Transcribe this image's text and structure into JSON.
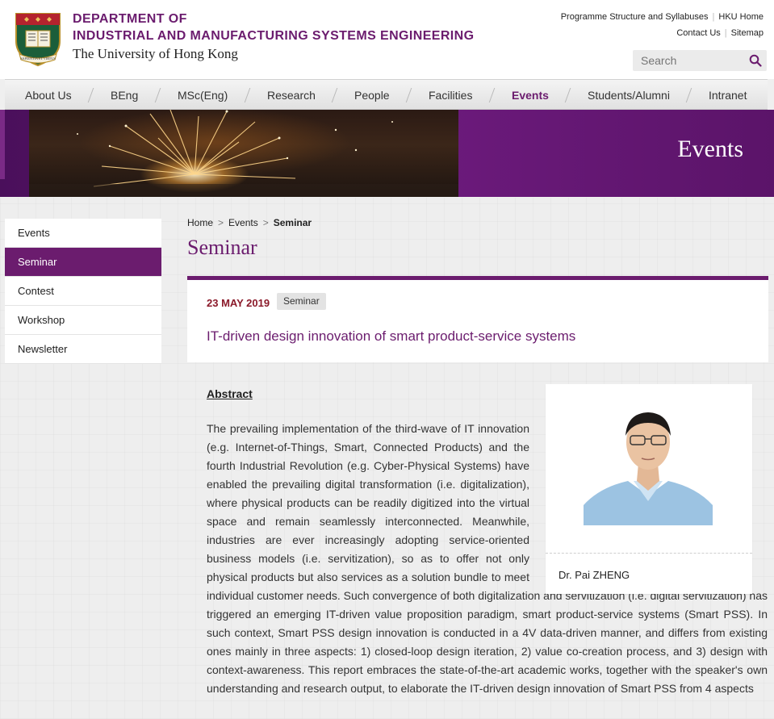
{
  "header": {
    "dept_line1": "DEPARTMENT OF",
    "dept_line2": "INDUSTRIAL AND MANUFACTURING SYSTEMS ENGINEERING",
    "university": "The University of Hong Kong",
    "crest_motto": "SAPIENTIA ET VIRTUS",
    "top_links_row1": [
      "Programme Structure and Syllabuses",
      "HKU Home"
    ],
    "top_links_row2": [
      "Contact Us",
      "Sitemap"
    ],
    "search_placeholder": "Search"
  },
  "nav": {
    "items": [
      "About Us",
      "BEng",
      "MSc(Eng)",
      "Research",
      "People",
      "Facilities",
      "Events",
      "Students/Alumni",
      "Intranet"
    ],
    "active": "Events"
  },
  "banner": {
    "title": "Events"
  },
  "sidebar": {
    "items": [
      "Events",
      "Seminar",
      "Contest",
      "Workshop",
      "Newsletter"
    ],
    "active": "Seminar"
  },
  "breadcrumb": {
    "items": [
      "Home",
      "Events",
      "Seminar"
    ],
    "separator": ">"
  },
  "page_title": "Seminar",
  "event": {
    "date": "23 MAY 2019",
    "tag": "Seminar",
    "title": "IT-driven design innovation of smart product-service systems"
  },
  "abstract": {
    "heading": "Abstract",
    "text": "The prevailing implementation of the third-wave of IT innovation (e.g. Internet-of-Things, Smart, Connected Products) and the fourth Industrial Revolution (e.g. Cyber-Physical Systems) have enabled the prevailing digital transformation (i.e. digitalization), where physical products can be readily digitized into the virtual space and remain seamlessly interconnected. Meanwhile, industries are ever increasingly adopting service-oriented business models (i.e. servitization), so as to offer not only physical products but also services as a solution bundle to meet individual customer needs. Such convergence of both digitalization and servitization (i.e. digital servitization) has triggered an emerging IT-driven value proposition paradigm, smart product-service systems (Smart PSS). In such context, Smart PSS design innovation is conducted in a 4V data-driven manner, and differs from existing ones mainly in three aspects: 1) closed-loop design iteration, 2) value co-creation process, and 3) design with context-awareness. This report embraces the state-of-the-art academic works, together with the speaker's own understanding and research output, to elaborate the IT-driven design innovation of Smart PSS from 4 aspects"
  },
  "speaker": {
    "name": "Dr. Pai ZHENG"
  },
  "colors": {
    "brand_purple": "#6b1c6e",
    "date_red": "#8b1a2a"
  }
}
